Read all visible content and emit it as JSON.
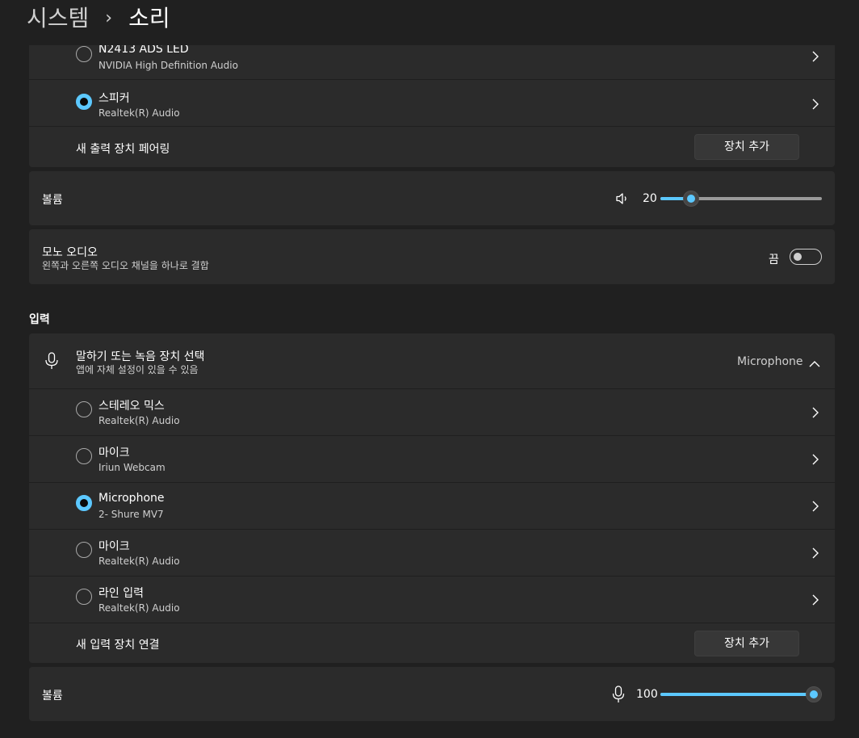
{
  "breadcrumb": {
    "parent": "시스템",
    "separator": "›",
    "current": "소리"
  },
  "output_devices": [
    {
      "name": "N2413 ADS LED",
      "driver": "NVIDIA High Definition Audio",
      "selected": false
    },
    {
      "name": "스피커",
      "driver": "Realtek(R) Audio",
      "selected": true
    }
  ],
  "output_pair": {
    "label": "새 출력 장치 페어링",
    "button": "장치 추가"
  },
  "output_volume": {
    "label": "볼륨",
    "value": "20",
    "level": 0.2,
    "icon": "speaker-icon"
  },
  "mono_audio": {
    "title": "모노 오디오",
    "subtitle": "왼쪽과 오른쪽 오디오 채널을 하나로 결합",
    "state": "끔",
    "on": false
  },
  "input_section": {
    "heading": "입력"
  },
  "input_select": {
    "title": "말하기 또는 녹음 장치 선택",
    "subtitle": "앱에 자체 설정이 있을 수 있음",
    "current": "Microphone",
    "icon": "microphone-icon"
  },
  "input_devices": [
    {
      "name": "스테레오 믹스",
      "driver": "Realtek(R) Audio",
      "selected": false
    },
    {
      "name": "마이크",
      "driver": "Iriun Webcam",
      "selected": false
    },
    {
      "name": "Microphone",
      "driver": "2- Shure MV7",
      "selected": true
    },
    {
      "name": "마이크",
      "driver": "Realtek(R) Audio",
      "selected": false
    },
    {
      "name": "라인 입력",
      "driver": "Realtek(R) Audio",
      "selected": false
    }
  ],
  "input_pair": {
    "label": "새 입력 장치 연결",
    "button": "장치 추가"
  },
  "input_volume": {
    "label": "볼륨",
    "value": "100",
    "level": 1.0,
    "icon": "microphone-icon"
  },
  "colors": {
    "accent": "#5cc8ff",
    "card": "#2b2b2b",
    "background": "#202020"
  }
}
